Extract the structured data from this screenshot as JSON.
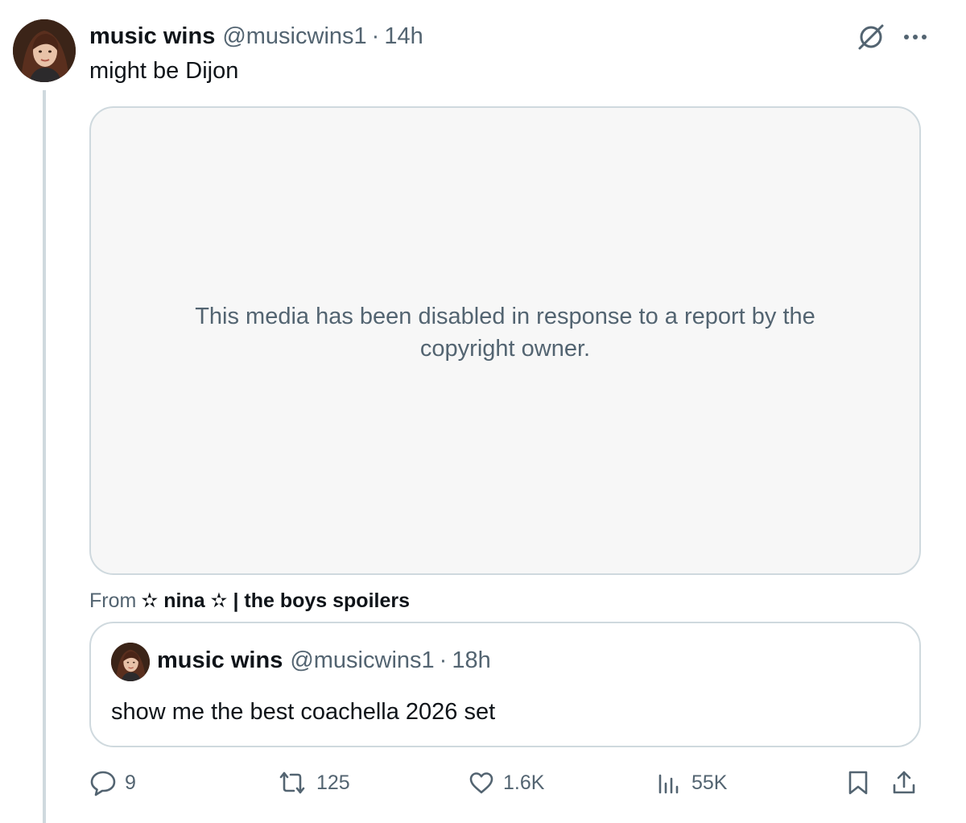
{
  "tweet": {
    "author_name": "music wins",
    "author_handle": "@musicwins1",
    "separator": "·",
    "time": "14h",
    "text": "might be Dijon",
    "media_message": "This media has been disabled in response to a report by the copyright owner.",
    "from_label": "From",
    "from_source": "✫ nina ✫ | the boys spoilers"
  },
  "quote": {
    "author_name": "music wins",
    "author_handle": "@musicwins1",
    "separator": "·",
    "time": "18h",
    "text": "show me the best coachella 2026 set"
  },
  "actions": {
    "replies": "9",
    "reposts": "125",
    "likes": "1.6K",
    "views": "55K"
  },
  "icons": {
    "grok": "grok-icon",
    "more": "more-icon",
    "reply": "reply-icon",
    "repost": "repost-icon",
    "like": "heart-icon",
    "views": "views-icon",
    "bookmark": "bookmark-icon",
    "share": "share-icon"
  },
  "colors": {
    "text_primary": "#0f1419",
    "text_secondary": "#536471",
    "border": "#cfd9de",
    "media_bg": "#f7f7f7"
  }
}
